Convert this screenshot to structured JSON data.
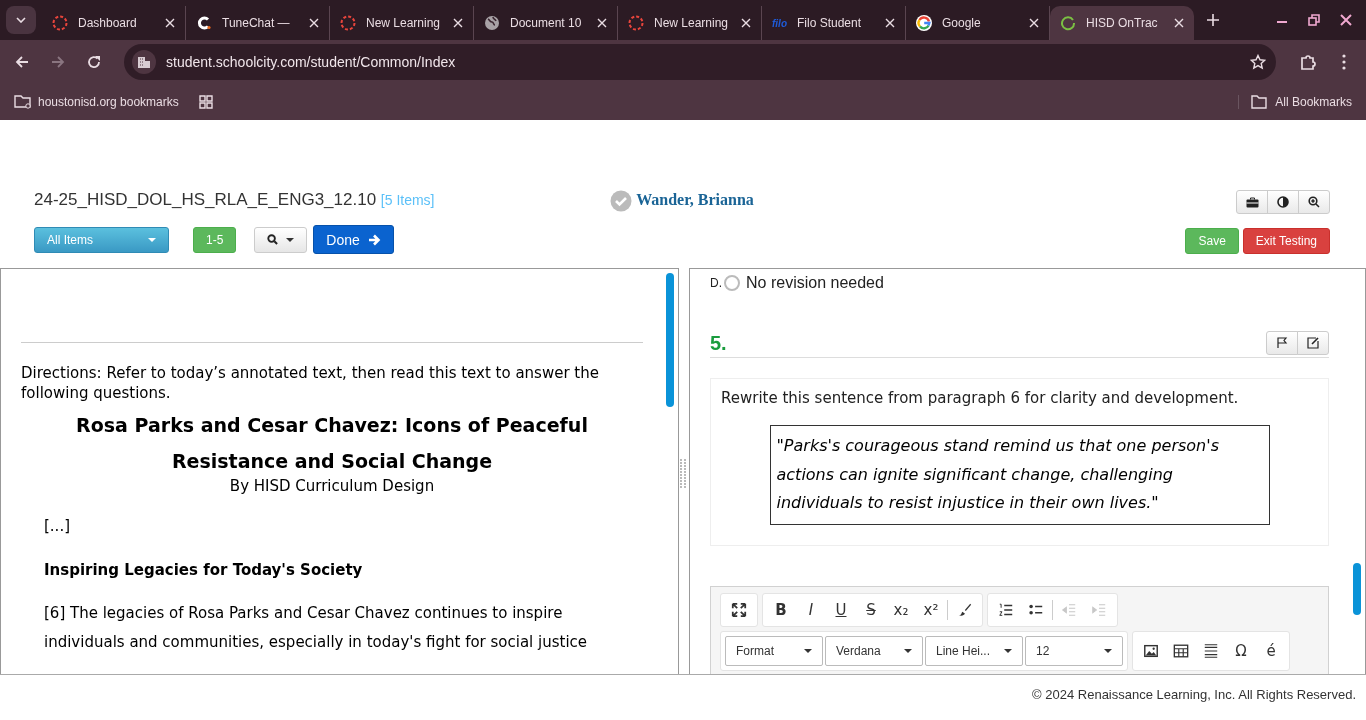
{
  "browser": {
    "tabs": [
      {
        "title": "Dashboard",
        "kind": "dashed",
        "selected": false
      },
      {
        "title": "TuneChat —",
        "kind": "arc",
        "selected": false
      },
      {
        "title": "New Learning",
        "kind": "dashed",
        "selected": false
      },
      {
        "title": "Document 10",
        "kind": "globe",
        "selected": false
      },
      {
        "title": "New Learning",
        "kind": "dashed",
        "selected": false
      },
      {
        "title": "Filo Student",
        "kind": "wordmark",
        "logo": "filo",
        "selected": false
      },
      {
        "title": "Google",
        "kind": "ring",
        "selected": false
      },
      {
        "title": "HISD OnTrac",
        "kind": "spinner",
        "selected": true
      }
    ],
    "url": "student.schoolcity.com/student/Common/Index",
    "bookmarks": [
      {
        "label": "houstonisd.org bookmarks"
      }
    ],
    "all_bookmarks": "All Bookmarks"
  },
  "header": {
    "test_title": "24-25_HISD_DOL_HS_RLA_E_ENG3_12.10",
    "item_count": "[5 Items]",
    "student": "Wander, Brianna",
    "item_filter": "All Items",
    "range": "1-5",
    "done": "Done",
    "save": "Save",
    "exit": "Exit Testing"
  },
  "passage": {
    "directions": "Directions: Refer to today’s annotated text, then read this text to answer the following questions.",
    "title": "Rosa Parks and Cesar Chavez: Icons of Peaceful Resistance and Social Change",
    "byline": "By HISD Curriculum Design",
    "ellipsis": "[...]",
    "section_heading": "Inspiring Legacies for Today's Society",
    "paragraph": "[6] The legacies of Rosa Parks and Cesar Chavez continues to inspire individuals and communities, especially in today's fight for social justice"
  },
  "question": {
    "previous_option": {
      "letter": "D.",
      "text": "No revision needed",
      "selected": false
    },
    "number": "5.",
    "prompt": "Rewrite this sentence from paragraph 6 for clarity and development.",
    "quote": "\"Parks's courageous stand remind us that one person's actions can ignite significant change, challenging individuals to resist injustice in their own lives.\""
  },
  "editor": {
    "groups": [
      [
        {
          "kind": "maximize",
          "disabled": false
        }
      ],
      [
        {
          "kind": "bold",
          "label": "B",
          "disabled": false
        },
        {
          "kind": "italic",
          "label": "I",
          "disabled": false
        },
        {
          "kind": "underline",
          "label": "U",
          "disabled": false
        },
        {
          "kind": "strike",
          "label": "S",
          "disabled": false
        },
        {
          "kind": "text",
          "label": "x₂",
          "disabled": false
        },
        {
          "kind": "text",
          "label": "x²",
          "disabled": false
        },
        {
          "kind": "brush",
          "disabled": false
        }
      ],
      [
        {
          "kind": "numbered-list",
          "disabled": false
        },
        {
          "kind": "bulleted-list",
          "disabled": false
        },
        {
          "kind": "outdent",
          "disabled": true
        },
        {
          "kind": "indent",
          "disabled": true
        }
      ]
    ],
    "dropdowns": [
      "Format",
      "Verdana",
      "Line Hei...",
      "12"
    ],
    "insert": [
      {
        "kind": "image",
        "disabled": false
      },
      {
        "kind": "table",
        "disabled": false
      },
      {
        "kind": "rule",
        "disabled": false
      },
      {
        "kind": "text",
        "label": "Ω",
        "disabled": false
      },
      {
        "kind": "text",
        "label": "é",
        "disabled": false
      }
    ]
  },
  "footer": "© 2024 Renaissance Learning, Inc. All Rights Reserved."
}
